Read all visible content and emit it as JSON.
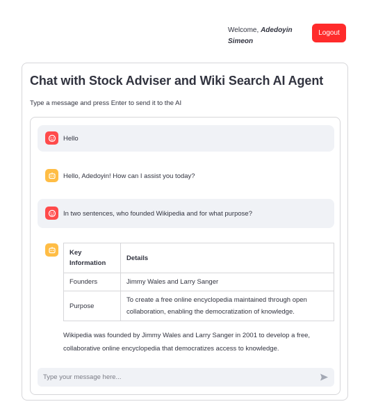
{
  "header": {
    "welcome_prefix": "Welcome, ",
    "user_first": "Adedoyin",
    "user_last": "Simeon",
    "logout_label": "Logout"
  },
  "panel": {
    "title": "Chat with Stock Adviser and Wiki Search AI Agent",
    "subtitle": "Type a message and press Enter to send it to the AI"
  },
  "messages": [
    {
      "role": "user",
      "avatar": "user-face-icon",
      "text": "Hello"
    },
    {
      "role": "assistant",
      "avatar": "bot-icon",
      "text": "Hello, Adedoyin! How can I assist you today?"
    },
    {
      "role": "user",
      "avatar": "user-face-icon",
      "text": "In two sentences, who founded Wikipedia and for what purpose?"
    },
    {
      "role": "assistant",
      "avatar": "bot-icon",
      "table": {
        "headers": [
          "Key Information",
          "Details"
        ],
        "rows": [
          [
            "Founders",
            "Jimmy Wales and Larry Sanger"
          ],
          [
            "Purpose",
            "To create a free online encyclopedia maintained through open collaboration, enabling the democratization of knowledge."
          ]
        ]
      },
      "text": "Wikipedia was founded by Jimmy Wales and Larry Sanger in 2001 to develop a free, collaborative online encyclopedia that democratizes access to knowledge."
    }
  ],
  "chat_input": {
    "placeholder": "Type your message here...",
    "value": "",
    "send_icon": "send-icon"
  },
  "colors": {
    "logout_bg": "#ff2b2b",
    "user_avatar": "#ff4b4b",
    "bot_avatar": "#ffbd45",
    "user_bubble": "#f0f2f6",
    "border": "#d6d6d9"
  }
}
